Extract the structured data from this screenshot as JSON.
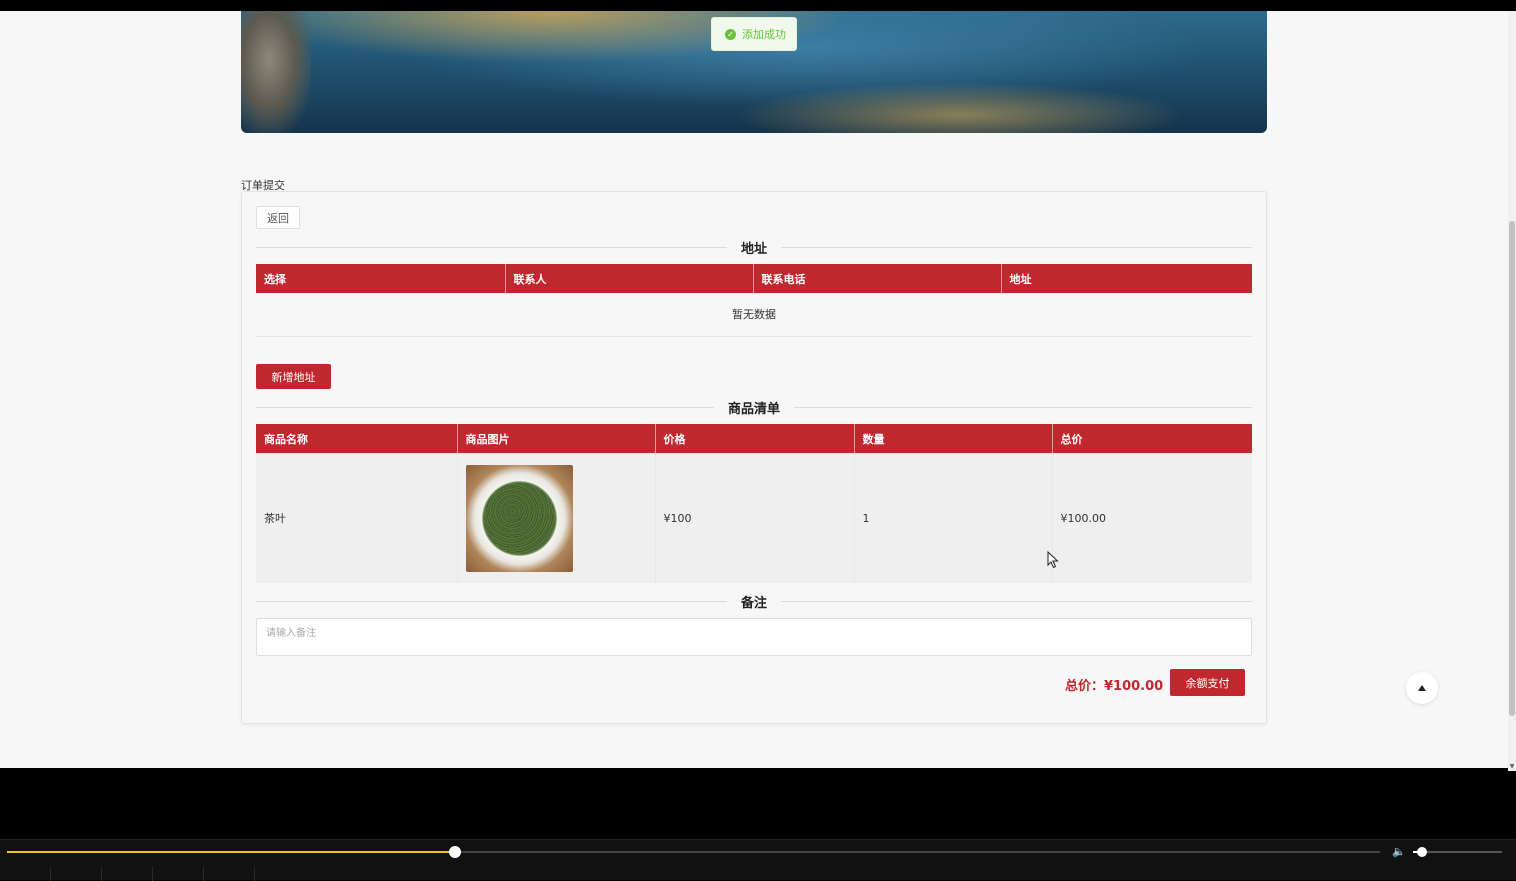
{
  "toast": {
    "text": "添加成功",
    "color": "#67c23a"
  },
  "page": {
    "label": "订单提交"
  },
  "buttons": {
    "back": "返回",
    "add_address": "新增地址",
    "pay": "余额支付"
  },
  "sections": {
    "address": "地址",
    "goods": "商品清单",
    "remark": "备注"
  },
  "address_table": {
    "headers": [
      "选择",
      "联系人",
      "联系电话",
      "地址"
    ],
    "empty_text": "暂无数据"
  },
  "goods_table": {
    "headers": [
      "商品名称",
      "商品图片",
      "价格",
      "数量",
      "总价"
    ],
    "rows": [
      {
        "name": "茶叶",
        "image": "tea-leaves-image",
        "price": "¥100",
        "quantity": "1",
        "total": "¥100.00"
      }
    ]
  },
  "remark": {
    "placeholder": "请输入备注",
    "value": ""
  },
  "summary": {
    "total_label": "总价：¥100.00"
  },
  "player": {
    "progress": 0.326,
    "volume": 0.1
  },
  "colors": {
    "accent": "#c0282f",
    "success": "#67c23a",
    "progress": "#e8c21a"
  }
}
